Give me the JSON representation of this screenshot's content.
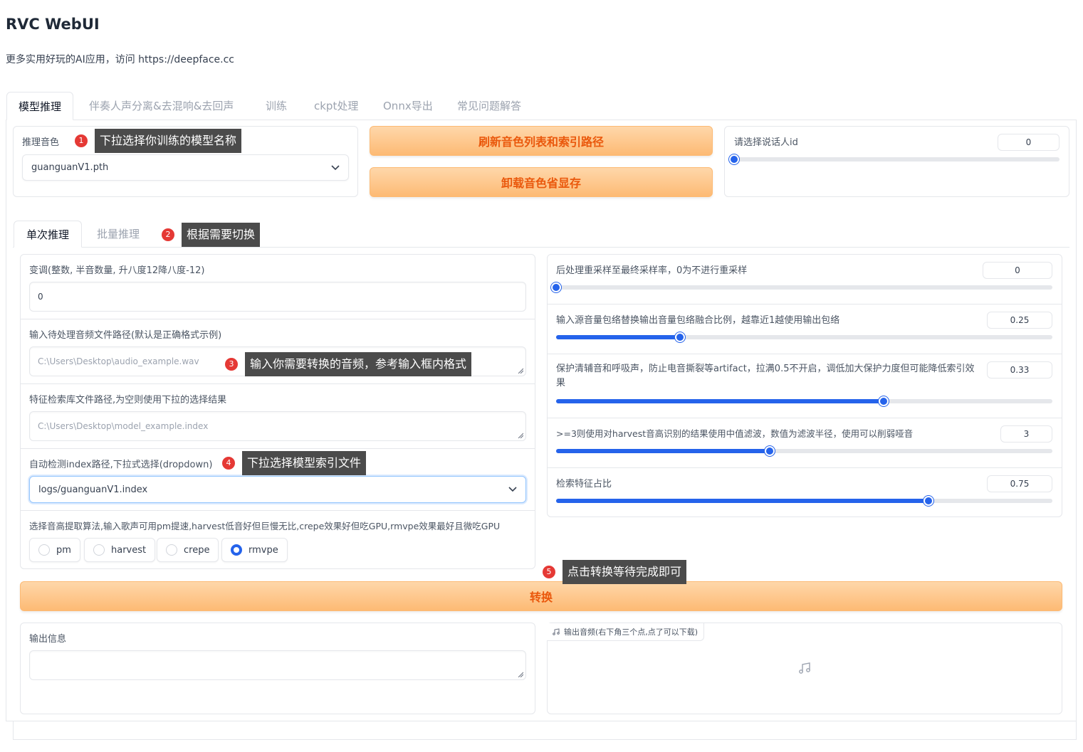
{
  "app": {
    "title": "RVC WebUI",
    "subtitle": "更多实用好玩的AI应用，访问 https://deepface.cc"
  },
  "top_tabs": [
    {
      "label": "模型推理",
      "active": true
    },
    {
      "label": "伴奏人声分离&去混响&去回声",
      "active": false
    },
    {
      "label": "训练",
      "active": false
    },
    {
      "label": "ckpt处理",
      "active": false
    },
    {
      "label": "Onnx导出",
      "active": false
    },
    {
      "label": "常见问题解答",
      "active": false
    }
  ],
  "model_panel": {
    "voice_label": "推理音色",
    "voice_value": "guanguanV1.pth",
    "refresh_button": "刷新音色列表和索引路径",
    "unload_button": "卸载音色省显存",
    "speaker_label": "请选择说话人id",
    "speaker_value": "0",
    "speaker_fraction": 0.0
  },
  "sub_tabs": [
    {
      "label": "单次推理",
      "active": true
    },
    {
      "label": "批量推理",
      "active": false
    }
  ],
  "single": {
    "transpose_label": "变调(整数, 半音数量, 升八度12降八度-12)",
    "transpose_value": "0",
    "input_path_label": "输入待处理音频文件路径(默认是正确格式示例)",
    "input_path_placeholder": "C:\\Users\\Desktop\\audio_example.wav",
    "index_path_label": "特征检索库文件路径,为空则使用下拉的选择结果",
    "index_path_placeholder": "C:\\Users\\Desktop\\model_example.index",
    "auto_index_label": "自动检测index路径,下拉式选择(dropdown)",
    "auto_index_value": "logs/guanguanV1.index",
    "f0_label": "选择音高提取算法,输入歌声可用pm提速,harvest低音好但巨慢无比,crepe效果好但吃GPU,rmvpe效果最好且微吃GPU",
    "f0_options": [
      {
        "label": "pm",
        "checked": false
      },
      {
        "label": "harvest",
        "checked": false
      },
      {
        "label": "crepe",
        "checked": false
      },
      {
        "label": "rmvpe",
        "checked": true
      }
    ]
  },
  "sliders": {
    "resample": {
      "label": "后处理重采样至最终采样率，0为不进行重采样",
      "value": "0",
      "fraction": 0.0
    },
    "rms_mix": {
      "label": "输入源音量包络替换输出音量包络融合比例，越靠近1越使用输出包络",
      "value": "0.25",
      "fraction": 0.25
    },
    "protect": {
      "label": "保护清辅音和呼吸声，防止电音撕裂等artifact，拉满0.5不开启，调低加大保护力度但可能降低索引效果",
      "value": "0.33",
      "fraction": 0.66
    },
    "filter_radius": {
      "label": ">=3则使用对harvest音高识别的结果使用中值滤波，数值为滤波半径，使用可以削弱哑音",
      "value": "3",
      "fraction": 0.43
    },
    "index_rate": {
      "label": "检索特征占比",
      "value": "0.75",
      "fraction": 0.75
    }
  },
  "convert_button": "转换",
  "output": {
    "info_label": "输出信息",
    "info_value": "",
    "audio_label": "输出音频(右下角三个点,点了可以下载)"
  },
  "callouts": [
    {
      "num": "1",
      "text": "下拉选择你训练的模型名称"
    },
    {
      "num": "2",
      "text": "根据需要切换"
    },
    {
      "num": "3",
      "text": "输入你需要转换的音频，参考输入框内格式"
    },
    {
      "num": "4",
      "text": "下拉选择模型索引文件"
    },
    {
      "num": "5",
      "text": "点击转换等待完成即可"
    }
  ],
  "colors": {
    "accent": "#2563eb",
    "button_orange": "#fdba74",
    "button_text": "#ea580c",
    "callout_red": "#e53935",
    "callout_bg": "#4b4b4b"
  }
}
